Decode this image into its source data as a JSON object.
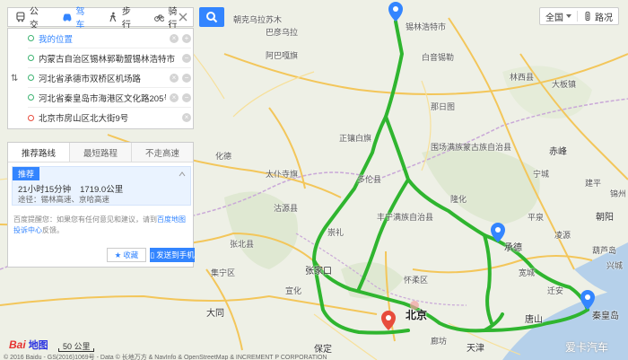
{
  "transport_modes": [
    {
      "label": "公交",
      "icon": "bus-icon"
    },
    {
      "label": "驾车",
      "icon": "car-icon"
    },
    {
      "label": "步行",
      "icon": "walk-icon"
    },
    {
      "label": "骑行",
      "icon": "bike-icon"
    }
  ],
  "active_mode": "驾车",
  "waypoints": [
    {
      "text": "我的位置",
      "link": true
    },
    {
      "text": "内蒙古自治区锡林郭勒盟锡林浩特市",
      "link": false
    },
    {
      "text": "河北省承德市双桥区机场路",
      "link": false
    },
    {
      "text": "河北省秦皇岛市海港区文化路205号",
      "link": false
    },
    {
      "text": "北京市房山区北大街9号",
      "link": false
    }
  ],
  "route_tabs": [
    "推荐路线",
    "最短路程",
    "不走高速"
  ],
  "recommended": {
    "badge": "推荐",
    "duration": "21小时15分钟",
    "distance": "1719.0公里",
    "via": "途径：锡林高速、京哈高速"
  },
  "feedback": {
    "prefix": "百度提醒您：如果您有任何意见和建议，请到",
    "link": "百度地图投诉中心",
    "suffix": "反馈。"
  },
  "actions": {
    "collect": "收藏",
    "send": "发送到手机"
  },
  "top_right": {
    "region": "全国",
    "region_icon": "chevron-down-icon",
    "layer": "路况",
    "layer_icon": "traffic-icon"
  },
  "map_labels": [
    {
      "text": "锡林浩特市",
      "cls": "city"
    },
    {
      "text": "巴彦乌拉",
      "cls": ""
    },
    {
      "text": "朝克乌拉苏木",
      "cls": ""
    },
    {
      "text": "阿巴嘎旗",
      "cls": ""
    },
    {
      "text": "白音锡勒",
      "cls": ""
    },
    {
      "text": "林西县",
      "cls": ""
    },
    {
      "text": "大板镇",
      "cls": ""
    },
    {
      "text": "那日图",
      "cls": ""
    },
    {
      "text": "正镶白旗",
      "cls": ""
    },
    {
      "text": "太仆寺旗",
      "cls": ""
    },
    {
      "text": "多伦县",
      "cls": ""
    },
    {
      "text": "围场满族蒙古族自治县",
      "cls": ""
    },
    {
      "text": "赤峰",
      "cls": "city"
    },
    {
      "text": "宁城",
      "cls": ""
    },
    {
      "text": "建平",
      "cls": ""
    },
    {
      "text": "沽源县",
      "cls": ""
    },
    {
      "text": "丰宁满族自治县",
      "cls": ""
    },
    {
      "text": "隆化",
      "cls": ""
    },
    {
      "text": "平泉",
      "cls": ""
    },
    {
      "text": "凌源",
      "cls": ""
    },
    {
      "text": "张北县",
      "cls": ""
    },
    {
      "text": "崇礼",
      "cls": ""
    },
    {
      "text": "张家口",
      "cls": "city"
    },
    {
      "text": "承德",
      "cls": "city"
    },
    {
      "text": "宽城",
      "cls": ""
    },
    {
      "text": "朝阳",
      "cls": "city"
    },
    {
      "text": "怀柔区",
      "cls": ""
    },
    {
      "text": "北京",
      "cls": "capital"
    },
    {
      "text": "天津",
      "cls": "city"
    },
    {
      "text": "唐山",
      "cls": "city"
    },
    {
      "text": "秦皇岛",
      "cls": "city"
    },
    {
      "text": "保定",
      "cls": "city"
    },
    {
      "text": "大同",
      "cls": "city"
    },
    {
      "text": "廊坊",
      "cls": ""
    },
    {
      "text": "迁安",
      "cls": ""
    },
    {
      "text": "兴城",
      "cls": ""
    },
    {
      "text": "葫芦岛",
      "cls": ""
    },
    {
      "text": "锦州",
      "cls": ""
    },
    {
      "text": "集宁区",
      "cls": ""
    },
    {
      "text": "化德",
      "cls": ""
    },
    {
      "text": "宣化",
      "cls": ""
    }
  ],
  "bottom": {
    "logo_bai": "Bai",
    "logo_du": "地图",
    "scale": "50 公里",
    "copyright": "© 2016 Baidu - GS(2016)1069号 - Data © 长地万方 & NavInfo & OpenStreetMap & INCREMENT P CORPORATION",
    "watermark": "爱卡汽车"
  }
}
